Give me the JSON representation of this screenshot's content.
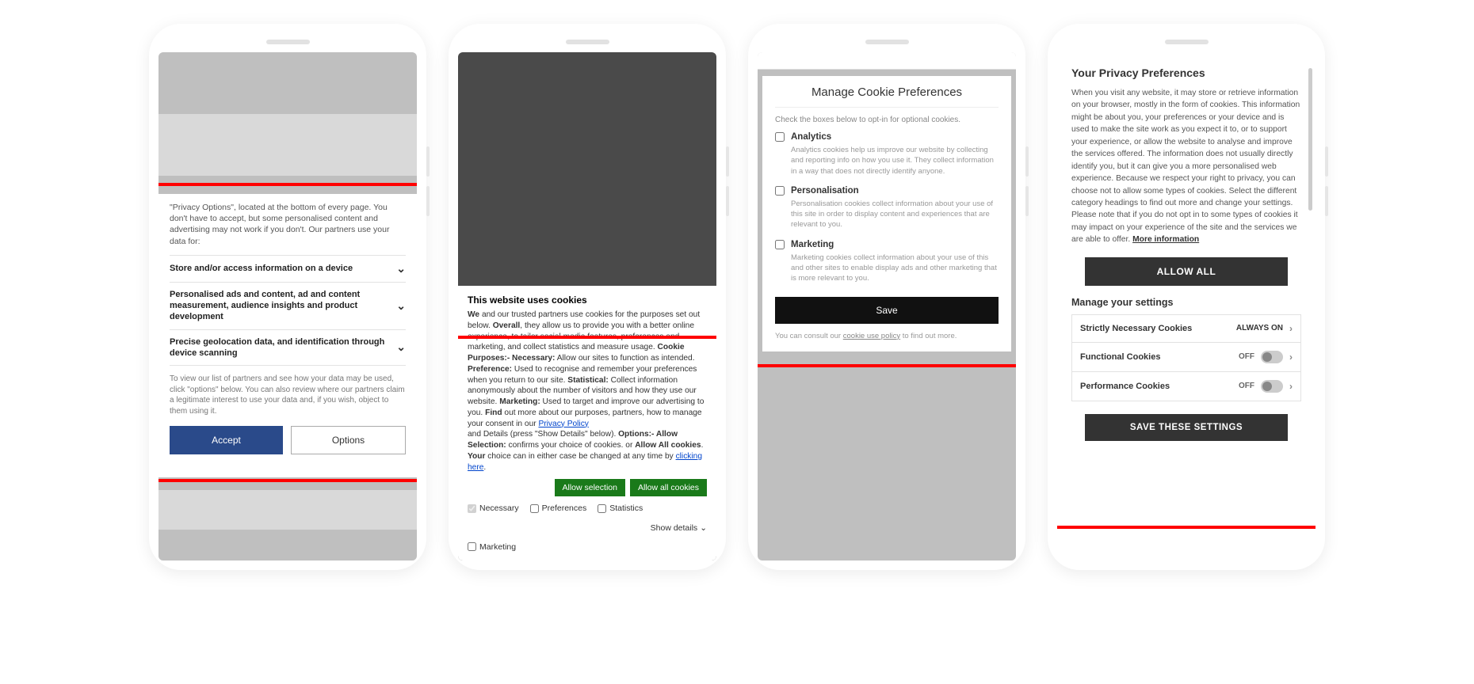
{
  "screen1": {
    "intro": "\"Privacy Options\", located at the bottom of every page. You don't have to accept, but some personalised content and advertising may not work if you don't. Our partners use your data for:",
    "items": [
      "Store and/or access information on a device",
      "Personalised ads and content, ad and content measurement, audience insights and product development",
      "Precise geolocation data, and identification through device scanning"
    ],
    "note": "To view our list of partners and see how your data may be used, click \"options\" below. You can also review where our partners claim a legitimate interest to use your data and, if you wish, object to them using it.",
    "accept": "Accept",
    "options": "Options"
  },
  "screen2": {
    "title": "This website uses cookies",
    "body_plain": "We and our trusted partners use cookies for the purposes set out below. Overall, they allow us to provide you with a better online experience, to tailor social media features, preferences and marketing, and collect statistics and measure usage. Cookie Purposes:- Necessary: Allow our sites to function as intended. Preference: Used to recognise and remember your preferences when you return to our site. Statistical: Collect information anonymously about the number of visitors and how they use our website. Marketing: Used to target and improve our advertising to you. Find out more about our purposes, partners, how to manage your consent in our Privacy Policy and Details (press \"Show Details\" below). Options:- Allow Selection: confirms your choice of cookies. or Allow All cookies. Your choice can in either case be changed at any time by clicking here.",
    "allow_selection": "Allow selection",
    "allow_all": "Allow all cookies",
    "checks": {
      "necessary": "Necessary",
      "preferences": "Preferences",
      "statistics": "Statistics",
      "marketing": "Marketing"
    },
    "show_details": "Show details"
  },
  "screen3": {
    "title": "Manage Cookie Preferences",
    "sub": "Check the boxes below to opt-in for optional cookies.",
    "opts": [
      {
        "label": "Analytics",
        "desc": "Analytics cookies help us improve our website by collecting and reporting info on how you use it. They collect information in a way that does not directly identify anyone."
      },
      {
        "label": "Personalisation",
        "desc": "Personalisation cookies collect information about your use of this site in order to display content and experiences that are relevant to you."
      },
      {
        "label": "Marketing",
        "desc": "Marketing cookies collect information about your use of this and other sites to enable display ads and other marketing that is more relevant to you."
      }
    ],
    "save": "Save",
    "foot_pre": "You can consult our ",
    "foot_link": "cookie use policy",
    "foot_post": " to find out more."
  },
  "screen4": {
    "title": "Your Privacy Preferences",
    "body": "When you visit any website, it may store or retrieve information on your browser, mostly in the form of cookies. This information might be about you, your preferences or your device and is used to make the site work as you expect it to, or to support your experience, or allow the website to analyse and improve the services offered. The information does not usually directly identify you, but it can give you a more personalised web experience. Because we respect your right to privacy, you can choose not to allow some types of cookies. Select the different category headings to find out more and change your settings. Please note that if you do not opt in to some types of cookies it may impact on your experience of the site and the services we are able to offer.  ",
    "more_info": "More information",
    "allow_all": "ALLOW ALL",
    "manage": "Manage your settings",
    "rows": [
      {
        "label": "Strictly Necessary Cookies",
        "state": "ALWAYS ON",
        "toggle": false
      },
      {
        "label": "Functional Cookies",
        "state": "OFF",
        "toggle": true
      },
      {
        "label": "Performance Cookies",
        "state": "OFF",
        "toggle": true
      }
    ],
    "save": "SAVE THESE SETTINGS"
  }
}
